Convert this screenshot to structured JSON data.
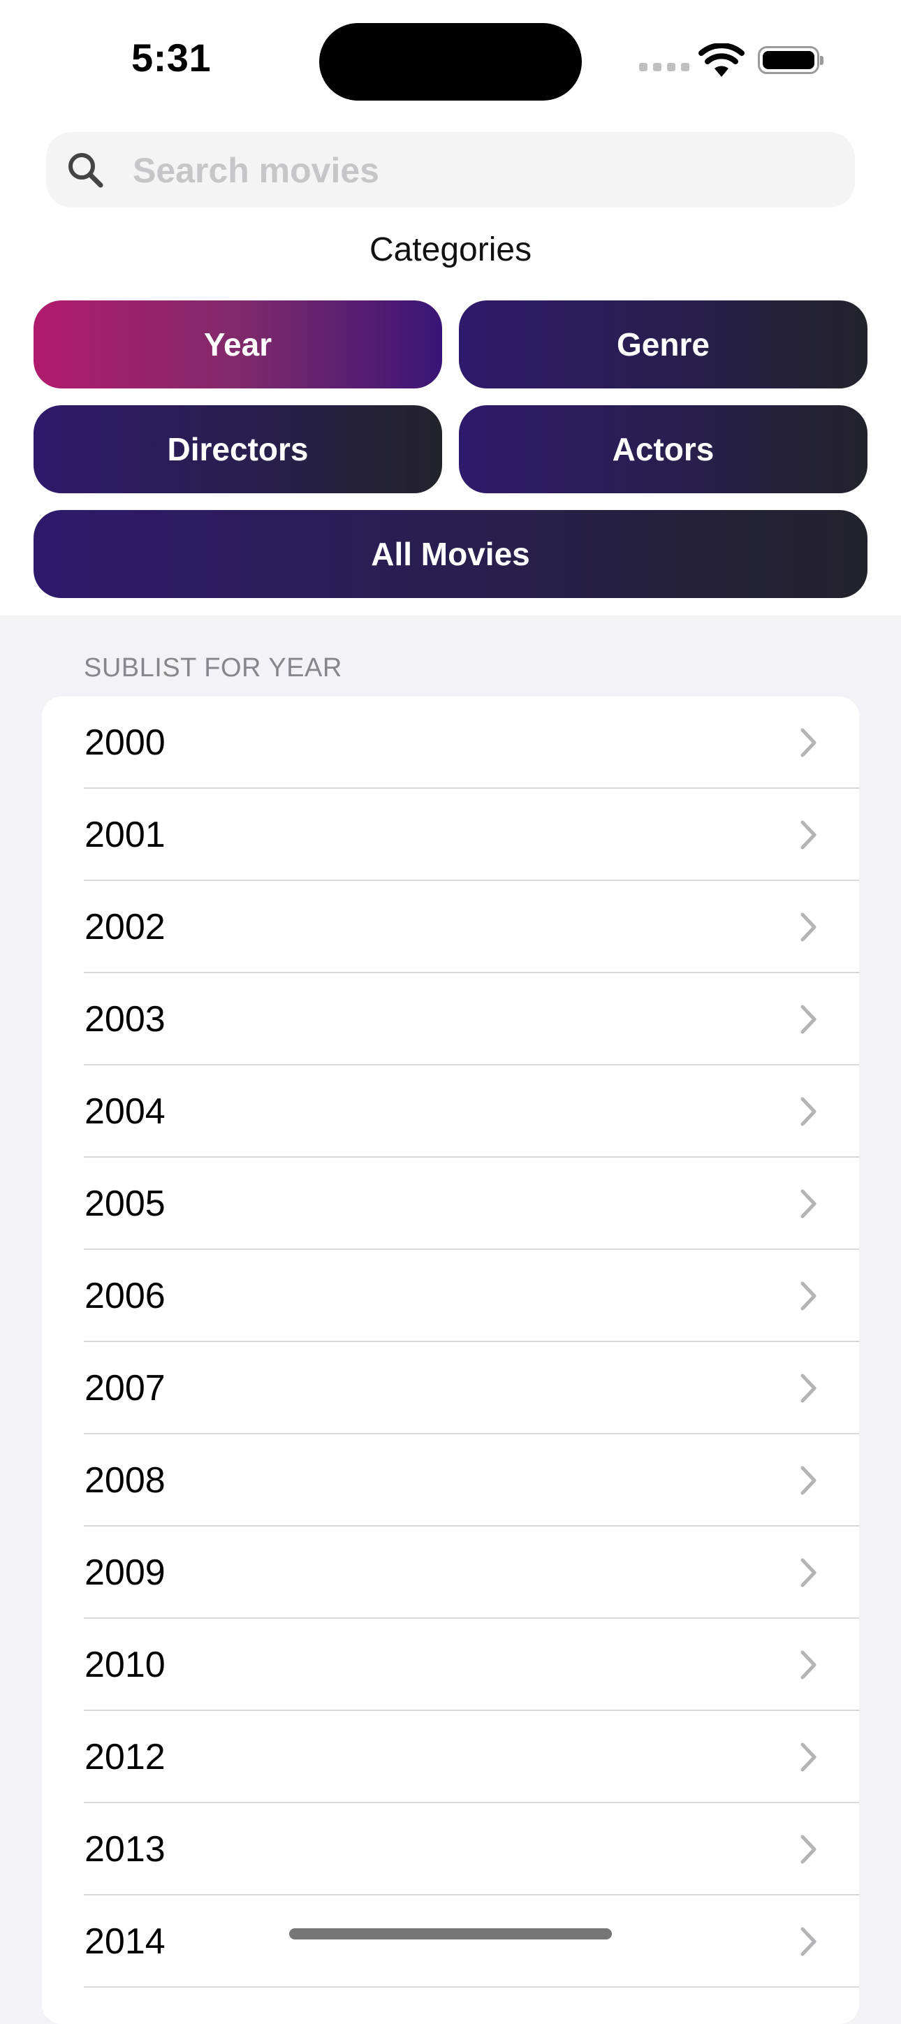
{
  "status_bar": {
    "time": "5:31"
  },
  "search": {
    "placeholder": "Search movies"
  },
  "categories": {
    "title": "Categories",
    "year_label": "Year",
    "genre_label": "Genre",
    "directors_label": "Directors",
    "actors_label": "Actors",
    "all_movies_label": "All Movies",
    "selected": "Year"
  },
  "sublist": {
    "header": "SUBLIST FOR YEAR",
    "items": [
      "2000",
      "2001",
      "2002",
      "2003",
      "2004",
      "2005",
      "2006",
      "2007",
      "2008",
      "2009",
      "2010",
      "2012",
      "2013",
      "2014"
    ]
  },
  "colors": {
    "active_gradient_start": "#b11b6d",
    "active_gradient_end": "#3a1576",
    "button_gradient_start": "#2e1a6b",
    "button_gradient_end": "#23232c",
    "background": "#f2f2f7"
  },
  "icons": {
    "search": "search-icon",
    "row_disclosure": "chevron-right-icon",
    "wifi": "wifi-icon",
    "battery": "battery-icon"
  }
}
